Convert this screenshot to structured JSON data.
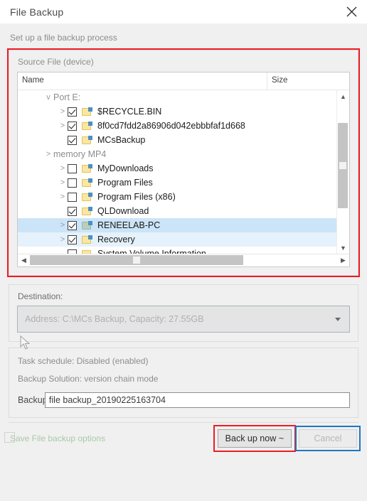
{
  "window": {
    "title": "File Backup",
    "close_icon": "close-icon",
    "subtitle": "Set up a file backup process"
  },
  "source": {
    "group_label": "Source File (device)",
    "columns": {
      "name": "Name",
      "size": "Size"
    },
    "rows": [
      {
        "label": "Port E:",
        "type": "drive",
        "indent": 0,
        "chevron": "v",
        "checkbox": "none",
        "icon": "none",
        "selected": "none"
      },
      {
        "label": "$RECYCLE.BIN",
        "type": "folder",
        "indent": 1,
        "chevron": ">",
        "checkbox": "checked",
        "icon": "folder-link",
        "selected": "none"
      },
      {
        "label": "8f0cd7fdd2a86906d042ebbbfaf1d668",
        "type": "folder",
        "indent": 1,
        "chevron": ">",
        "checkbox": "checked",
        "icon": "folder-link",
        "selected": "none"
      },
      {
        "label": "MCsBackup",
        "type": "folder",
        "indent": 1,
        "chevron": "",
        "checkbox": "checked",
        "icon": "folder-link",
        "selected": "none"
      },
      {
        "label": "memory MP4",
        "type": "drive",
        "indent": 0,
        "chevron": ">",
        "checkbox": "none",
        "icon": "none",
        "selected": "none"
      },
      {
        "label": "MyDownloads",
        "type": "folder",
        "indent": 1,
        "chevron": ">",
        "checkbox": "unchecked",
        "icon": "folder-link",
        "selected": "none"
      },
      {
        "label": "Program Files",
        "type": "folder",
        "indent": 1,
        "chevron": ">",
        "checkbox": "unchecked",
        "icon": "folder-link",
        "selected": "none"
      },
      {
        "label": "Program Files (x86)",
        "type": "folder",
        "indent": 1,
        "chevron": ">",
        "checkbox": "unchecked",
        "icon": "folder-link",
        "selected": "none"
      },
      {
        "label": "QLDownload",
        "type": "folder",
        "indent": 1,
        "chevron": "",
        "checkbox": "checked",
        "icon": "folder-link",
        "selected": "none"
      },
      {
        "label": "RENEELAB-PC",
        "type": "folder",
        "indent": 1,
        "chevron": ">",
        "checkbox": "checked",
        "icon": "folder-pc",
        "selected": "dark"
      },
      {
        "label": "Recovery",
        "type": "folder",
        "indent": 1,
        "chevron": ">",
        "checkbox": "checked",
        "icon": "folder-link",
        "selected": "light"
      },
      {
        "label": "System Volume Information",
        "type": "folder",
        "indent": 1,
        "chevron": "",
        "checkbox": "unchecked",
        "icon": "folder-plain",
        "selected": "none"
      }
    ],
    "scroll": {
      "up_arrow": "chevron-up-icon",
      "down_arrow": "chevron-down-icon",
      "left_arrow": "chevron-left-icon",
      "right_arrow": "chevron-right-icon"
    }
  },
  "destination": {
    "label": "Destination:",
    "value": "Address: C:\\MCs Backup, Capacity: 27.55GB",
    "caret_icon": "chevron-down-icon"
  },
  "options": {
    "task_schedule": "Task schedule: Disabled (enabled)",
    "backup_solution": "Backup Solution: version chain mode",
    "backup_name_label": "Backup name:",
    "backup_name_value": "file backup_20190225163704"
  },
  "footer": {
    "save_options": "Save File backup options",
    "save_icon": "save-disk-icon",
    "backup_now": "Back up now ~",
    "cancel": "Cancel"
  },
  "colors": {
    "annotation_red": "#ee1c25",
    "annotation_blue": "#1f77c2",
    "selection_dark": "#cce4f7",
    "selection_light": "#e5f2fc",
    "folder_yellow": "#fbe6a2"
  }
}
